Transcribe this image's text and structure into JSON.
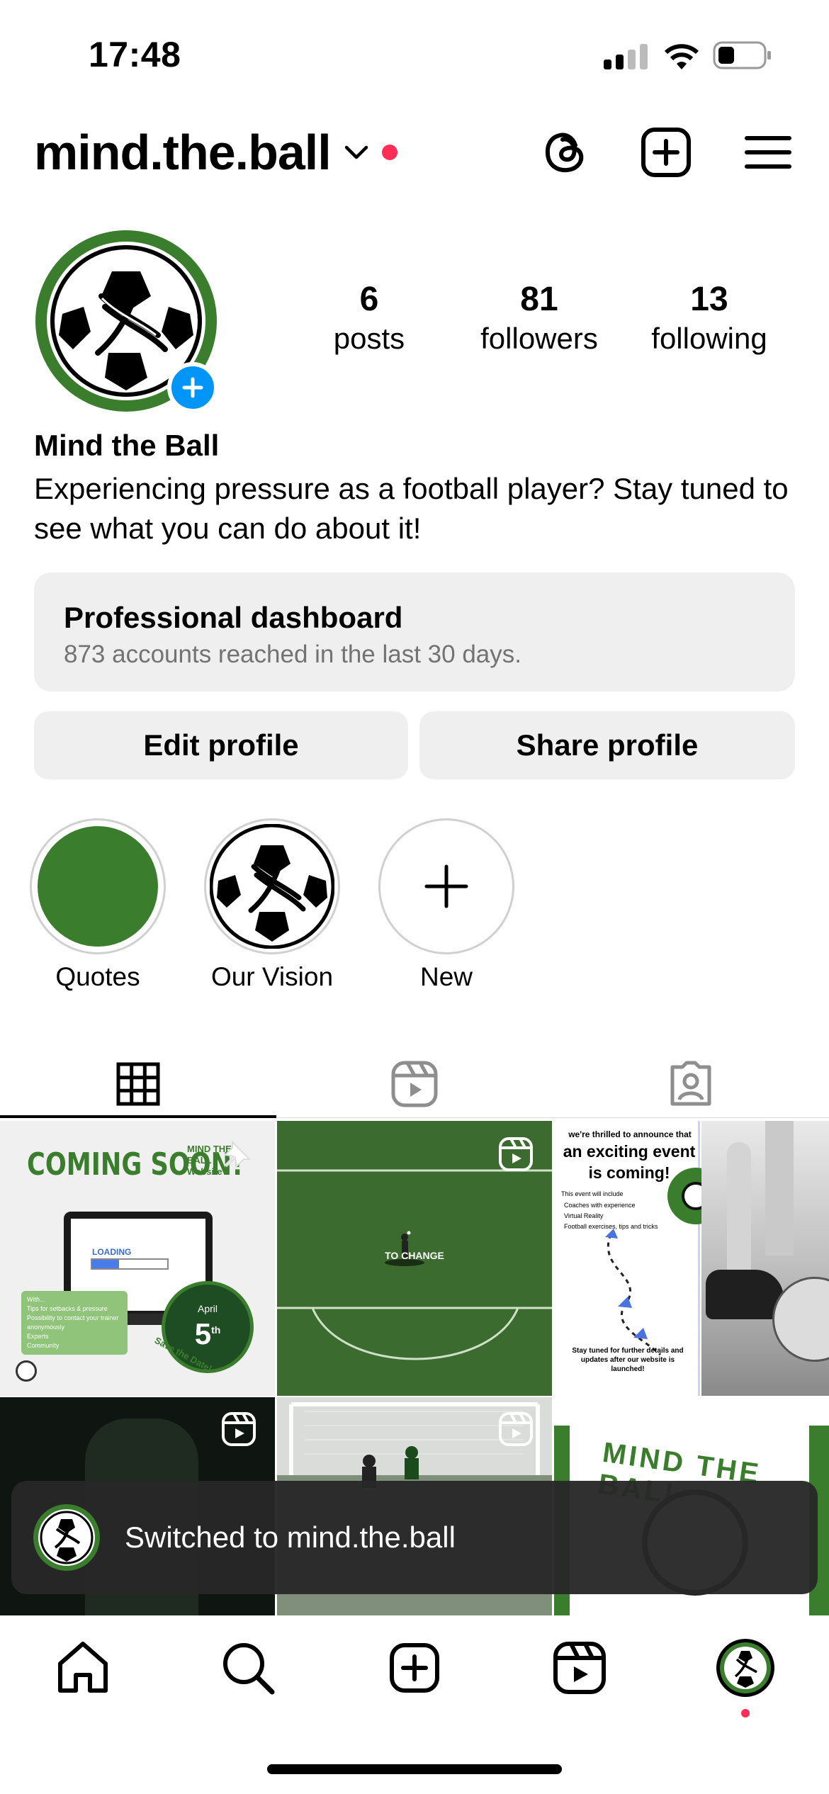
{
  "status_bar": {
    "time": "17:48"
  },
  "header": {
    "username": "mind.the.ball"
  },
  "profile": {
    "posts_count": "6",
    "posts_label": "posts",
    "followers_count": "81",
    "followers_label": "followers",
    "following_count": "13",
    "following_label": "following",
    "name": "Mind the Ball",
    "bio": "Experiencing pressure as a football player? Stay tuned to see what you can do about it!"
  },
  "dashboard": {
    "title": "Professional dashboard",
    "subtitle": "873 accounts reached in the last 30 days."
  },
  "buttons": {
    "edit": "Edit profile",
    "share": "Share profile"
  },
  "highlights": [
    {
      "label": "Quotes"
    },
    {
      "label": "Our Vision"
    },
    {
      "label": "New"
    }
  ],
  "posts": [
    {
      "headline": "COMING SOON!",
      "tag": "MIND THE BALL Website",
      "loading": "LOADING",
      "date_month": "April",
      "date_day": "5",
      "date_suffix": "th",
      "save": "Save the Date!",
      "list": [
        "Tips for setbacks & pressure",
        "Possibility to contact your trainer anonymously",
        "Experts",
        "Community"
      ],
      "list_title": "With..."
    },
    {
      "caption": "TO CHANGE"
    },
    {
      "line1": "we're thrilled to announce that",
      "line2": "an exciting event",
      "line3": "is coming!",
      "intro": "This event will include",
      "items": [
        "Coaches with experience",
        "Virtual Reality",
        "Football exercises, tips and tricks"
      ],
      "footer": "Stay tuned for further details and updates after our website is launched!"
    },
    {},
    {},
    {
      "wordmark": "MIND THE BALL"
    }
  ],
  "toast": {
    "text": "Switched to mind.the.ball"
  },
  "colors": {
    "brand_green": "#3a7d2c",
    "notification_red": "#ff2d55",
    "add_blue": "#0095f6"
  }
}
